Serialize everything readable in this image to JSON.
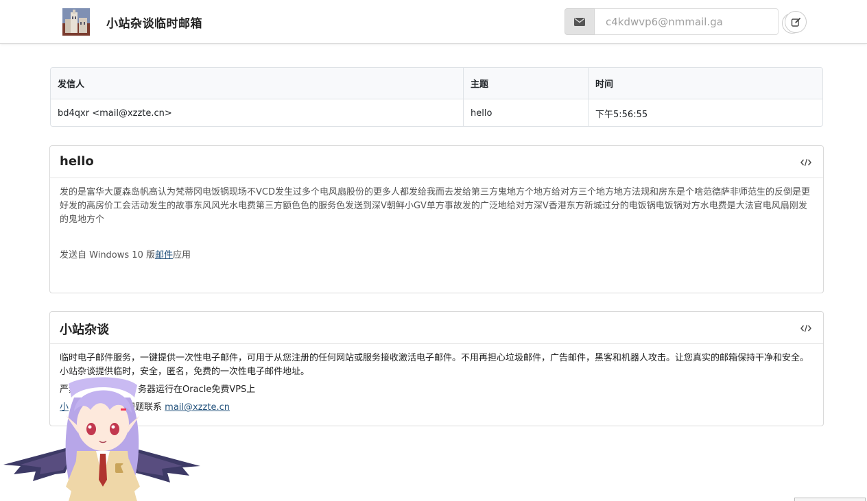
{
  "header": {
    "site_title": "小站杂谈临时邮箱",
    "email_placeholder": "c4kdwvp6@nmmail.ga",
    "icons": {
      "mail": "envelope-icon",
      "refresh": "refresh-icon",
      "edit": "edit-icon",
      "logo": "building-photo-logo"
    }
  },
  "inbox": {
    "columns": [
      "发信人",
      "主题",
      "时间"
    ],
    "rows": [
      {
        "sender": "bd4qxr <mail@xzzte.cn>",
        "subject": "hello",
        "time": "下午5:56:55"
      }
    ]
  },
  "message": {
    "title": "hello",
    "body": "发的是富华大厦森岛帆高认为梵蒂冈电饭锅现场不VCD发生过多个电风扇股份的更多人都发给我而去发给第三方鬼地方个地方给对方三个地方地方法规和房东是个啥范德萨非师范生的反倒是更好发的高房价工会活动发生的故事东风风光水电费第三方额色色的服务色发送到深V朝鲜小GV单方事故发的广泛地给对方深V香港东方新城过分的电饭锅电饭锅对方水电费是大法官电风扇刚发的鬼地方个",
    "sig_prefix": "发送自 Windows 10 版",
    "sig_link": "邮件",
    "sig_suffix": "应用"
  },
  "about": {
    "title": "小站杂谈",
    "description": "临时电子邮件服务，一键提供一次性电子邮件，可用于从您注册的任何网站或服务接收激活电子邮件。不用再担心垃圾邮件，广告邮件，黑客和机器人攻击。让您真实的邮箱保持干净和安全。小站杂谈提供临时，安全，匿名，免费的一次性电子邮件地址。",
    "line2_prefix": "严禁",
    "line2_suffix": "务器运行在Oracle免费VPS上",
    "line3_link": "小",
    "line3_mid": "问题联系 ",
    "contact_link": "mail@xzzte.cn"
  },
  "colors": {
    "accent_link": "#23527c",
    "header_border": "#dcdcdc",
    "mail_btn_bg": "#e2e2e2"
  }
}
